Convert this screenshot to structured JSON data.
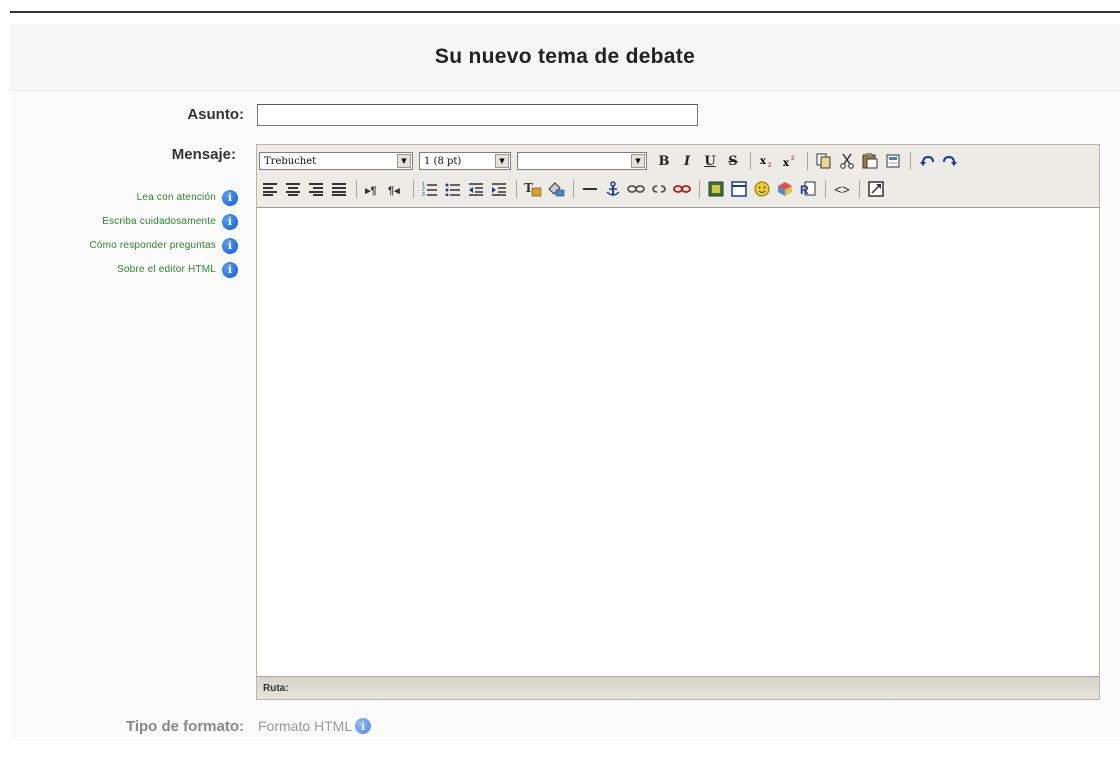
{
  "page": {
    "title": "Su nuevo tema de debate"
  },
  "form": {
    "asunto_label": "Asunto:",
    "asunto_value": "",
    "mensaje_label": "Mensaje:",
    "tipo_label": "Tipo de formato:",
    "tipo_value": "Formato HTML"
  },
  "help_links": [
    {
      "label": "Lea con atención"
    },
    {
      "label": "Escriba cuidadosamente"
    },
    {
      "label": "Cómo responder preguntas"
    },
    {
      "label": "Sobre el editor HTML"
    }
  ],
  "editor": {
    "font_select": "Trebuchet",
    "size_select": "1 (8 pt)",
    "style_select": "",
    "status_label": "Ruta:"
  },
  "toolbar_text": {
    "bold": "B",
    "italic": "I",
    "underline": "U",
    "strike": "S",
    "source": "<>"
  },
  "icons": {
    "info": "i"
  },
  "colors": {
    "help_link": "#2a8a2a",
    "info_icon": "#0b55d8",
    "toolbar_bg": "#ecebe6"
  }
}
